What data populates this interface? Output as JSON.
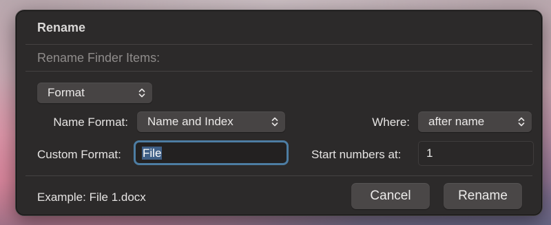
{
  "dialog": {
    "title": "Rename",
    "subtitle": "Rename Finder Items:"
  },
  "mode_popup": {
    "selected": "Format",
    "icon": "chevron-up-down-icon"
  },
  "name_format": {
    "label": "Name Format:",
    "selected": "Name and Index"
  },
  "where": {
    "label": "Where:",
    "selected": "after name"
  },
  "custom_format": {
    "label": "Custom Format:",
    "value": "File"
  },
  "start_numbers": {
    "label": "Start numbers at:",
    "value": "1"
  },
  "example": {
    "text": "Example: File 1.docx"
  },
  "buttons": {
    "cancel": "Cancel",
    "rename": "Rename"
  },
  "colors": {
    "dialog_background": "#2c2a2a",
    "focus_ring": "#4d7da3",
    "text_selection": "#3f5f86",
    "popup_background": "#474444"
  }
}
